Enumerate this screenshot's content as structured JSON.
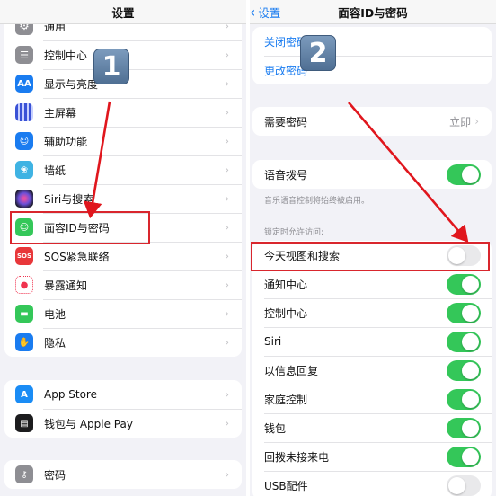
{
  "left": {
    "title": "设置",
    "group1": [
      {
        "label": "通用",
        "icon": "gear-icon",
        "color": "#8e8e93"
      },
      {
        "label": "控制中心",
        "icon": "switches-icon",
        "color": "#8e8e93"
      },
      {
        "label": "显示与亮度",
        "icon": "text-size-icon",
        "glyph": "AA",
        "color": "#1a7cf0"
      },
      {
        "label": "主屏幕",
        "icon": "home-screen-icon",
        "color": "#3a52d6"
      },
      {
        "label": "辅助功能",
        "icon": "accessibility-icon",
        "glyph": "☺",
        "color": "#1a7cf0"
      },
      {
        "label": "墙纸",
        "icon": "wallpaper-icon",
        "glyph": "❀",
        "color": "#3fb3e3"
      },
      {
        "label": "Siri与搜索",
        "icon": "siri-icon",
        "color": "#2a2a40"
      },
      {
        "label": "面容ID与密码",
        "icon": "face-id-icon",
        "glyph": "☺",
        "color": "#34c759"
      },
      {
        "label": "SOS紧急联络",
        "icon": "sos-icon",
        "glyph": "SOS",
        "color": "#e8373a"
      },
      {
        "label": "暴露通知",
        "icon": "exposure-icon",
        "glyph": "●",
        "color": "#ffffff"
      },
      {
        "label": "电池",
        "icon": "battery-icon",
        "glyph": "▬",
        "color": "#34c759"
      },
      {
        "label": "隐私",
        "icon": "hand-icon",
        "glyph": "✋",
        "color": "#1a7cf0"
      }
    ],
    "group2": [
      {
        "label": "App Store",
        "icon": "app-store-icon",
        "glyph": "A",
        "color": "#1a8cf5"
      },
      {
        "label": "钱包与 Apple Pay",
        "icon": "wallet-icon",
        "glyph": "▤",
        "color": "#1c1c1e"
      }
    ],
    "group3": [
      {
        "label": "密码",
        "icon": "key-icon",
        "glyph": "⚷",
        "color": "#8e8e93"
      }
    ]
  },
  "right": {
    "back_label": "设置",
    "title": "面容ID与密码",
    "passcode_links": [
      "关闭密码",
      "更改密码"
    ],
    "require_passcode": {
      "label": "需要密码",
      "value": "立即"
    },
    "voice_dial": {
      "label": "语音拨号",
      "on": true
    },
    "voice_note": "音乐语音控制将始终被启用。",
    "lock_header": "锁定时允许访问:",
    "lock_items": [
      {
        "label": "今天视图和搜索",
        "on": false
      },
      {
        "label": "通知中心",
        "on": true
      },
      {
        "label": "控制中心",
        "on": true
      },
      {
        "label": "Siri",
        "on": true
      },
      {
        "label": "以信息回复",
        "on": true
      },
      {
        "label": "家庭控制",
        "on": true
      },
      {
        "label": "钱包",
        "on": true
      },
      {
        "label": "回拨未接来电",
        "on": true
      },
      {
        "label": "USB配件",
        "on": false
      }
    ]
  },
  "annotations": {
    "step1": "1",
    "step2": "2",
    "highlight_color": "#d9262d"
  },
  "chevron": "›"
}
